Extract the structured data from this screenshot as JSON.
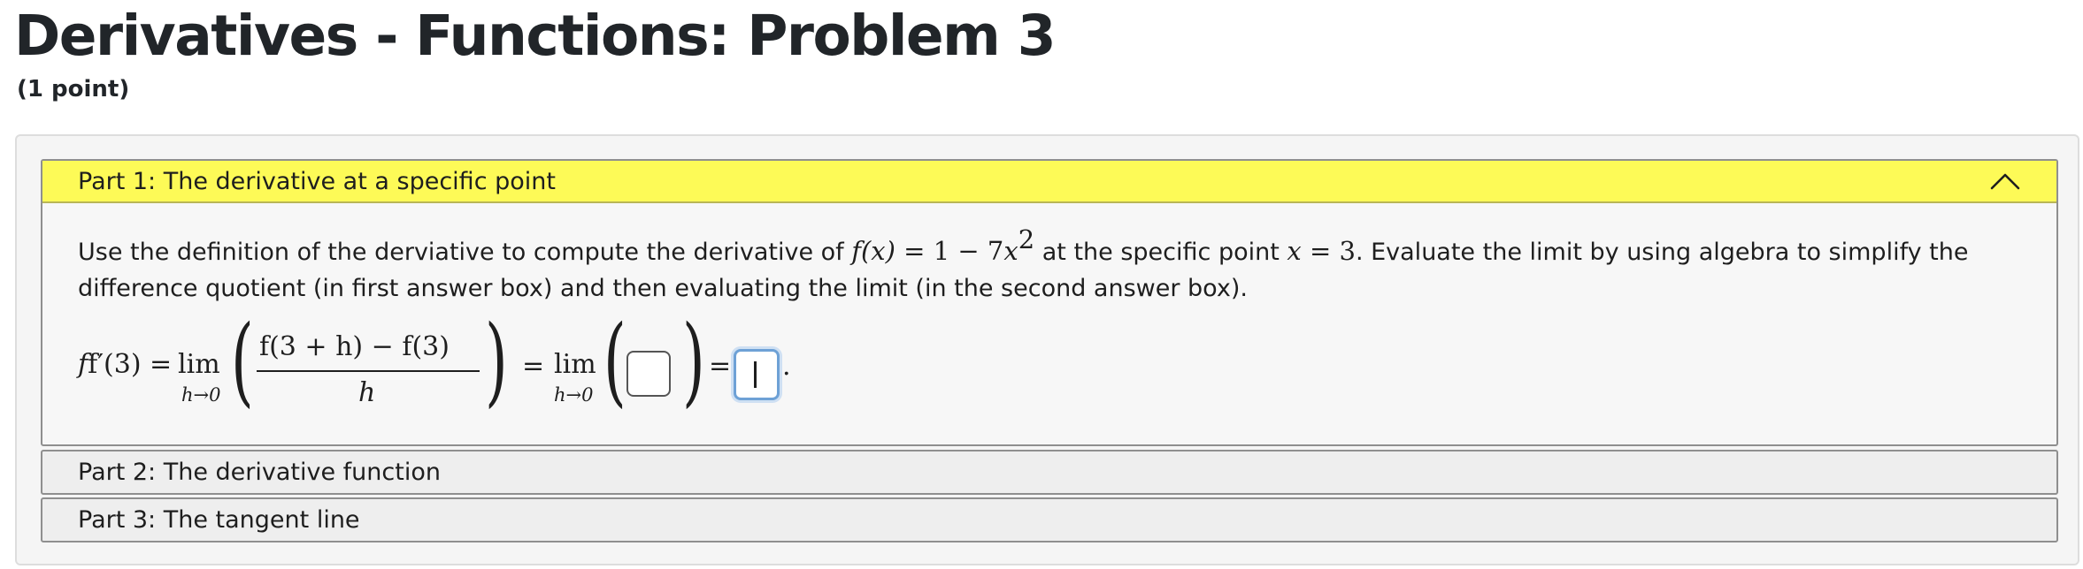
{
  "page": {
    "title": "Derivatives - Functions: Problem 3",
    "points": "(1 point)"
  },
  "parts": [
    {
      "label": "Part 1: The derivative at a specific point",
      "expanded": true,
      "header_color": "#fdfa57"
    },
    {
      "label": "Part 2: The derivative function",
      "expanded": false
    },
    {
      "label": "Part 3: The tangent line",
      "expanded": false
    }
  ],
  "problem": {
    "text_1": "Use the definition of the derviative to compute the derivative of ",
    "fx": "f(x)",
    "eq_1": " = 1 − 7",
    "x_var": "x",
    "exp": "2",
    "text_2": " at the specific point ",
    "x_eq": "x",
    "eq_2": " = 3",
    "text_3": ". Evaluate the limit by using algebra to simplify the difference quotient (in first answer box) and then evaluating the limit (in the second answer box)."
  },
  "formula": {
    "lhs": "f′(3) =",
    "lim": "lim",
    "lim_sub": "h→0",
    "numerator": "f(3 + h) − f(3)",
    "denominator": "h",
    "equals": "=",
    "lim2": "lim",
    "lim2_sub": "h→0",
    "equals2": "=",
    "period": "."
  },
  "answers": {
    "box1_value": "",
    "box2_value": ""
  }
}
